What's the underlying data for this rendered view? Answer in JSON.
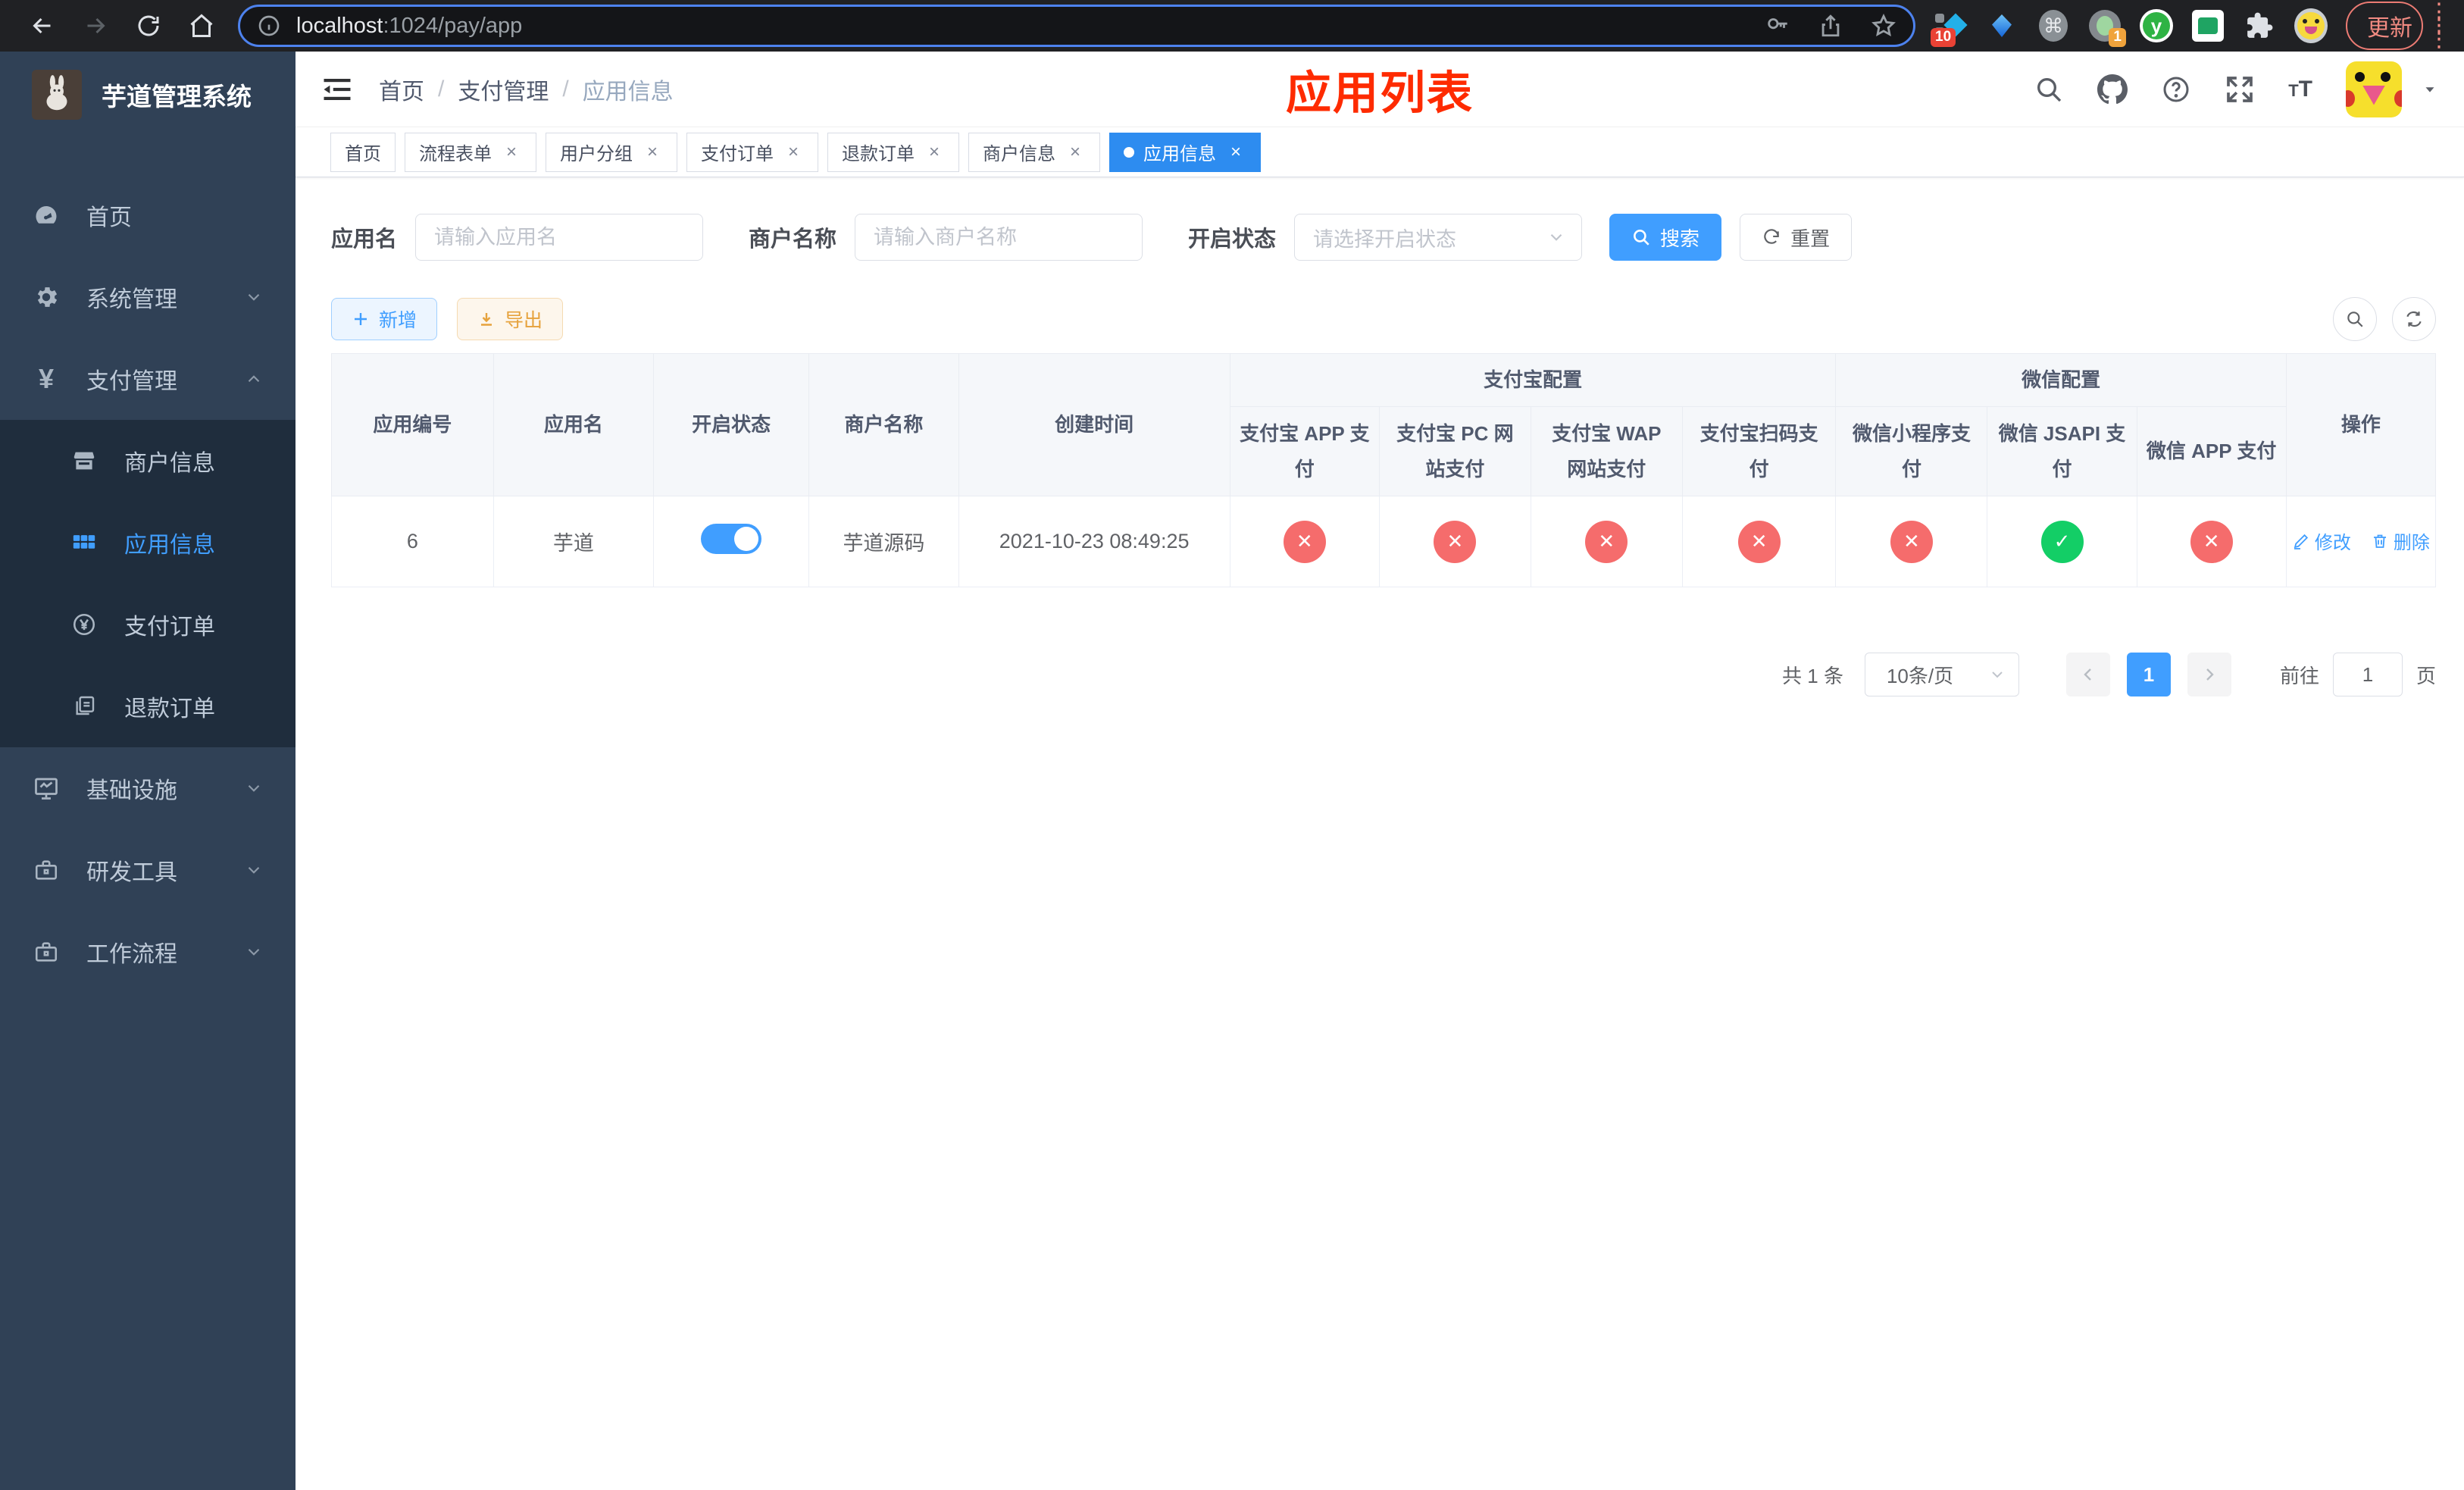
{
  "browser": {
    "url_host": "localhost",
    "url_rest": ":1024/pay/app",
    "ext_badge_blocker": "10",
    "ext_badge_session": "1",
    "update_label": "更新"
  },
  "sidebar": {
    "title": "芋道管理系统",
    "items": [
      {
        "label": "首页"
      },
      {
        "label": "系统管理"
      },
      {
        "label": "支付管理"
      },
      {
        "label": "商户信息"
      },
      {
        "label": "应用信息"
      },
      {
        "label": "支付订单"
      },
      {
        "label": "退款订单"
      },
      {
        "label": "基础设施"
      },
      {
        "label": "研发工具"
      },
      {
        "label": "工作流程"
      }
    ]
  },
  "header": {
    "breadcrumb": [
      "首页",
      "支付管理",
      "应用信息"
    ],
    "overlay_title": "应用列表"
  },
  "tabs": [
    {
      "label": "首页"
    },
    {
      "label": "流程表单"
    },
    {
      "label": "用户分组"
    },
    {
      "label": "支付订单"
    },
    {
      "label": "退款订单"
    },
    {
      "label": "商户信息"
    },
    {
      "label": "应用信息"
    }
  ],
  "filters": {
    "app_name_label": "应用名",
    "app_name_placeholder": "请输入应用名",
    "merchant_label": "商户名称",
    "merchant_placeholder": "请输入商户名称",
    "status_label": "开启状态",
    "status_placeholder": "请选择开启状态",
    "search_label": "搜索",
    "reset_label": "重置"
  },
  "toolbar": {
    "add_label": "新增",
    "export_label": "导出"
  },
  "table": {
    "group_alipay": "支付宝配置",
    "group_wechat": "微信配置",
    "headers": [
      "应用编号",
      "应用名",
      "开启状态",
      "商户名称",
      "创建时间",
      "支付宝 APP 支付",
      "支付宝 PC 网站支付",
      "支付宝 WAP 网站支付",
      "支付宝扫码支付",
      "微信小程序支付",
      "微信 JSAPI 支付",
      "微信 APP 支付",
      "操作"
    ],
    "rows": [
      {
        "id": "6",
        "name": "芋道",
        "enabled": true,
        "merchant": "芋道源码",
        "created": "2021-10-23 08:49:25",
        "statuses": [
          false,
          false,
          false,
          false,
          false,
          true,
          false
        ],
        "edit_label": "修改",
        "delete_label": "删除"
      }
    ]
  },
  "pagination": {
    "total": "共 1 条",
    "page_size": "10条/页",
    "current_page": "1",
    "goto_label": "前往",
    "goto_value": "1",
    "page_unit": "页"
  },
  "colors": {
    "accent": "#409eff",
    "danger": "#f56c6c",
    "success": "#13ce66",
    "title_red": "#fe2b00",
    "sidebar_bg": "#304156",
    "submenu_bg": "#1f2d3d"
  }
}
